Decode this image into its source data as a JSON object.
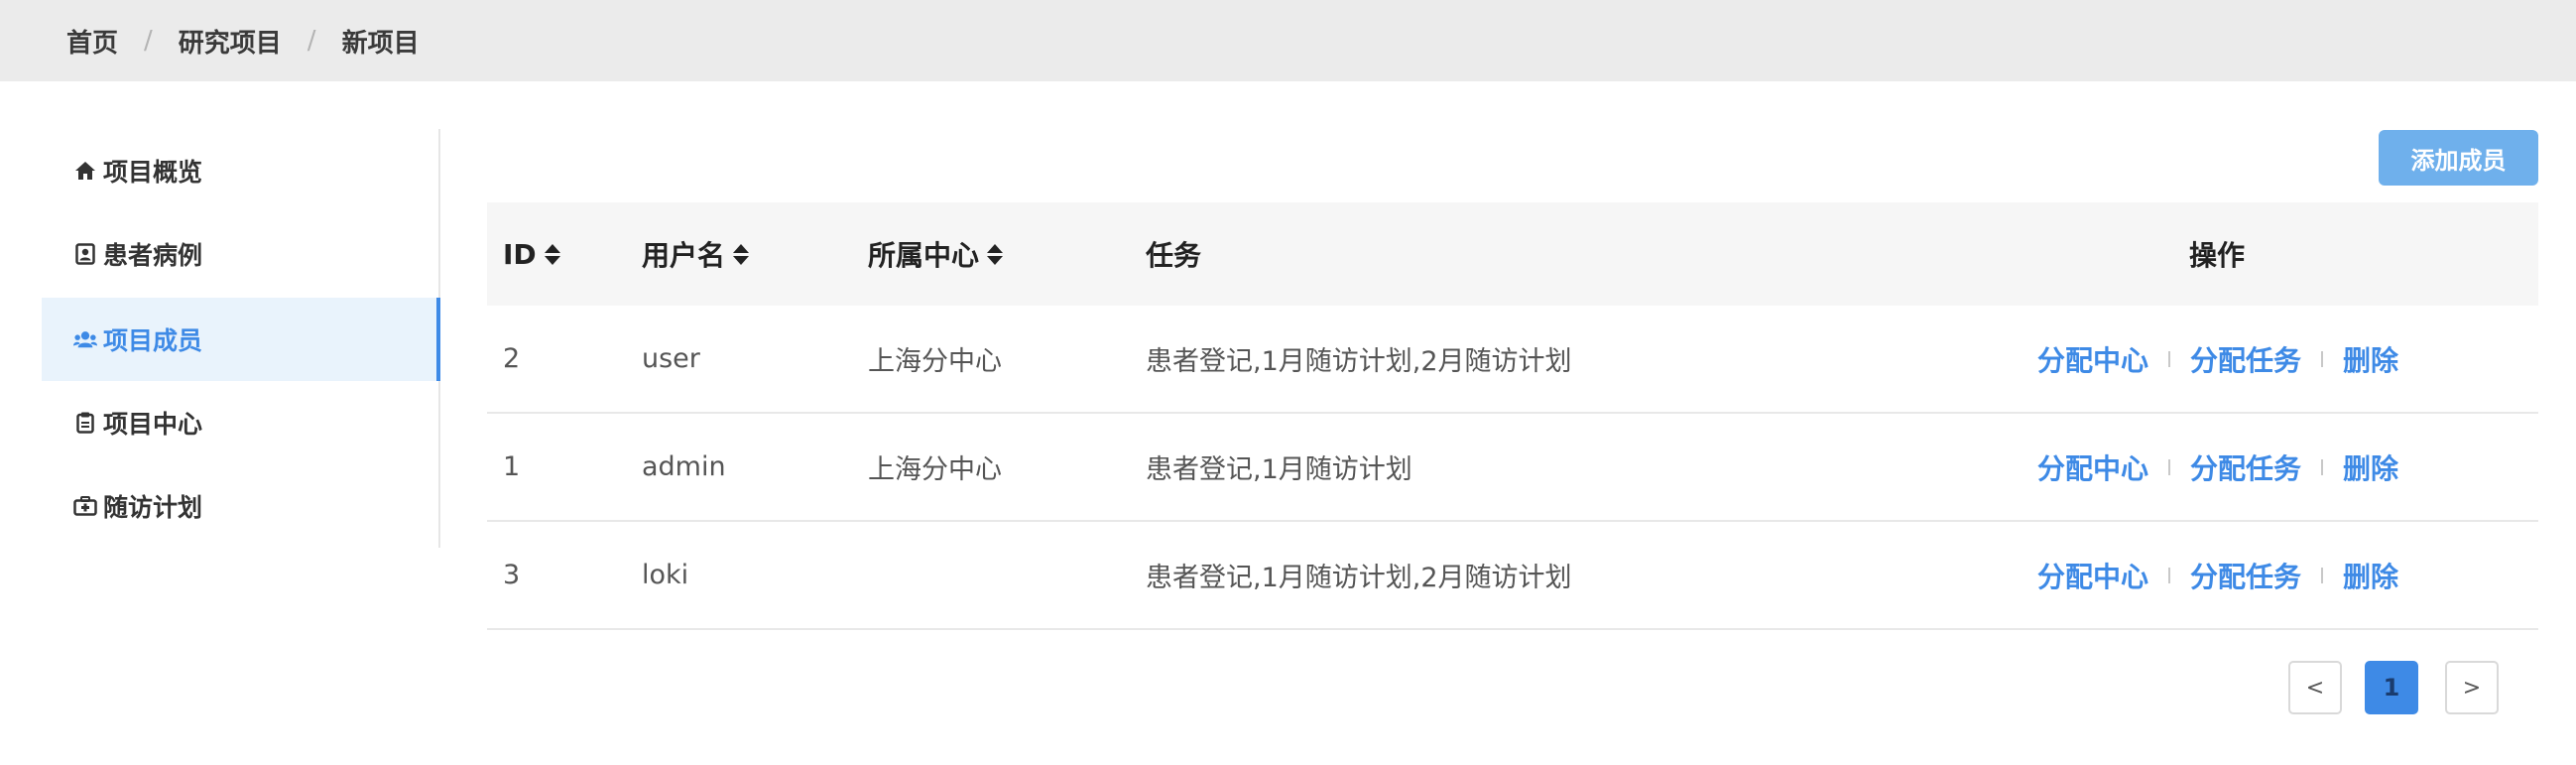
{
  "breadcrumb": {
    "items": [
      "首页",
      "研究项目",
      "新项目"
    ],
    "separator": "/"
  },
  "sidebar": {
    "items": [
      {
        "label": "项目概览",
        "icon": "home-icon",
        "active": false
      },
      {
        "label": "患者病例",
        "icon": "id-card-icon",
        "active": false
      },
      {
        "label": "项目成员",
        "icon": "users-icon",
        "active": true
      },
      {
        "label": "项目中心",
        "icon": "clipboard-icon",
        "active": false
      },
      {
        "label": "随访计划",
        "icon": "medkit-icon",
        "active": false
      }
    ]
  },
  "toolbar": {
    "add_member_label": "添加成员"
  },
  "table": {
    "headers": {
      "id": "ID",
      "username": "用户名",
      "center": "所属中心",
      "tasks": "任务",
      "actions": "操作"
    },
    "rows": [
      {
        "id": "2",
        "username": "user",
        "center": "上海分中心",
        "tasks": "患者登记,1月随访计划,2月随访计划"
      },
      {
        "id": "1",
        "username": "admin",
        "center": "上海分中心",
        "tasks": "患者登记,1月随访计划"
      },
      {
        "id": "3",
        "username": "loki",
        "center": "",
        "tasks": "患者登记,1月随访计划,2月随访计划"
      }
    ],
    "row_actions": {
      "assign_center": "分配中心",
      "assign_task": "分配任务",
      "delete": "删除"
    }
  },
  "pagination": {
    "prev": "<",
    "current": "1",
    "next": ">"
  },
  "colors": {
    "accent": "#3e8ae6",
    "button_bg": "#6fb0ec",
    "breadcrumb_bg": "#ebebeb",
    "header_bg": "#f6f6f6",
    "active_item_bg": "#e9f3fc"
  }
}
